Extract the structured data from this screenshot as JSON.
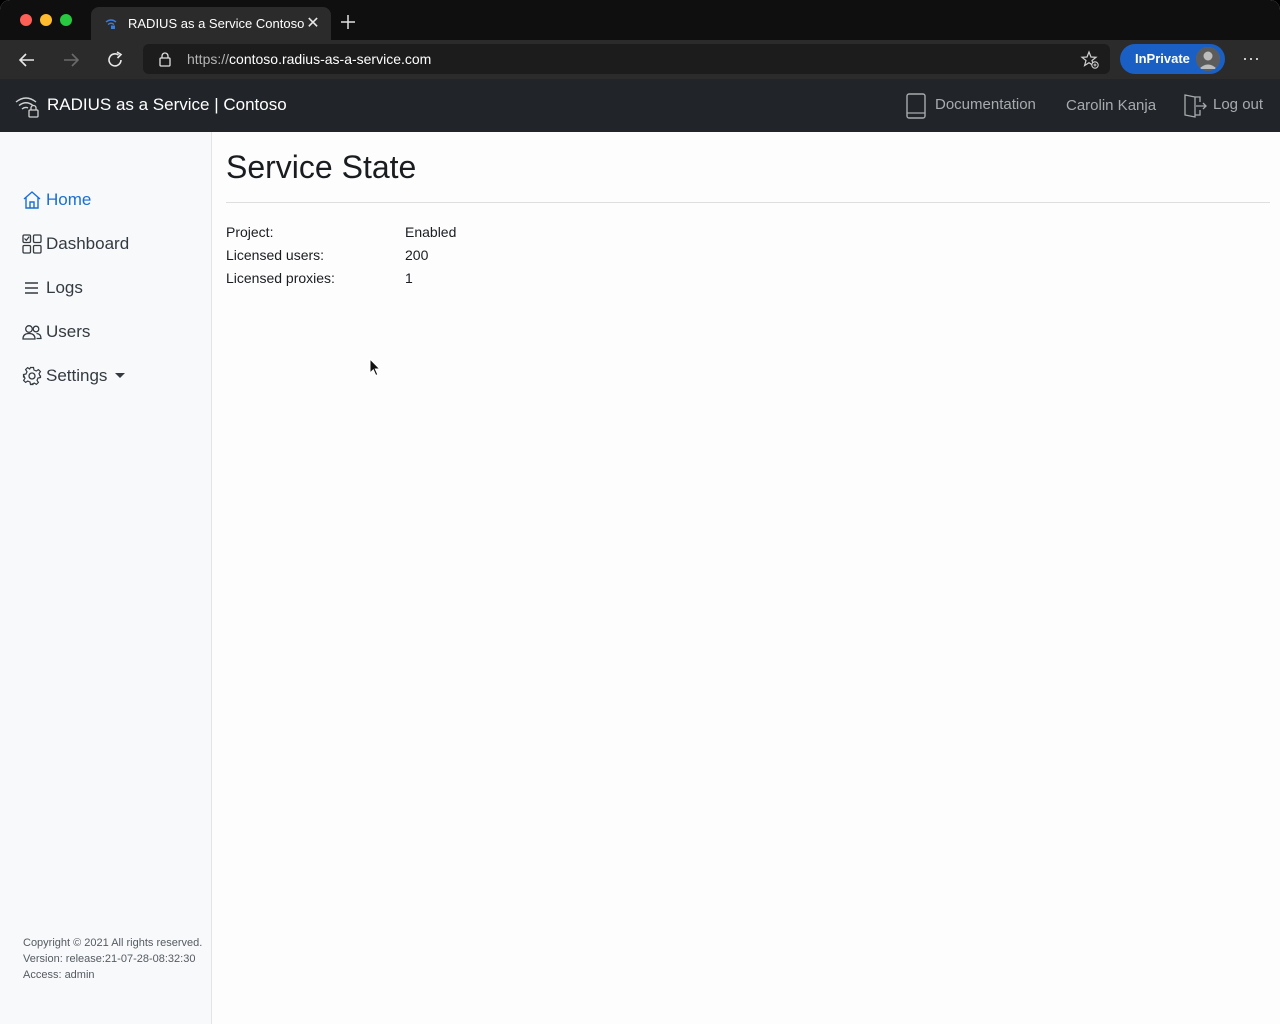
{
  "browser": {
    "tab_title": "RADIUS as a Service Contoso",
    "url_prefix": "https://",
    "url_host": "contoso.radius-as-a-service.com",
    "inprivate_label": "InPrivate"
  },
  "header": {
    "brand": "RADIUS as a Service | Contoso",
    "documentation": "Documentation",
    "user": "Carolin Kanja",
    "logout": "Log out"
  },
  "sidebar": {
    "items": [
      {
        "label": "Home",
        "icon": "home-icon",
        "active": true
      },
      {
        "label": "Dashboard",
        "icon": "dashboard-icon"
      },
      {
        "label": "Logs",
        "icon": "list-icon"
      },
      {
        "label": "Users",
        "icon": "users-icon"
      },
      {
        "label": "Settings",
        "icon": "gear-icon"
      }
    ],
    "footer": {
      "copyright": "Copyright © 2021 All rights reserved.",
      "version": "Version: release:21-07-28-08:32:30",
      "access": "Access: admin"
    }
  },
  "main": {
    "title": "Service State",
    "rows": [
      {
        "key": "Project:",
        "value": "Enabled"
      },
      {
        "key": "Licensed users:",
        "value": "200"
      },
      {
        "key": "Licensed proxies:",
        "value": "1"
      }
    ]
  },
  "colors": {
    "accent": "#1a6ed8",
    "appbar": "#212529",
    "sidebar": "#f8f9fa",
    "inprivate": "#1a5fc4"
  }
}
